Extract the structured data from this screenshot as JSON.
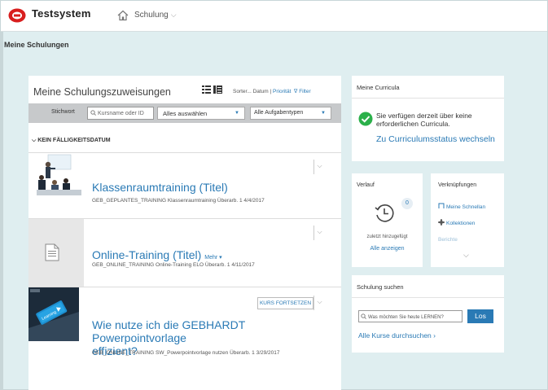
{
  "header": {
    "brand": "Testsystem",
    "nav_label": "Schulung",
    "nav_chevron": "⌵"
  },
  "page": {
    "title": "Meine Schulungen"
  },
  "main": {
    "heading": "Meine Schulungszuweisungen",
    "sort_prefix": "Sorter... Datum | ",
    "sort_priority": "Priorität",
    "sort_filter": "∇ Filter",
    "filter": {
      "keyword_label": "Stichwort",
      "search_placeholder": "Kursname oder ID",
      "select_all": "Alles auswählen",
      "select_types": "Alle Aufgabentypen"
    },
    "due_heading": "⌵ KEIN FÄLLIGKEITSDATUM",
    "items": [
      {
        "title": "Klassenraumtraining (Titel)",
        "meta": "GEB_GEPLANTES_TRAINING Klassenraumtraining Überarb. 1 4/4/2017"
      },
      {
        "title": "Online-Training (Titel)",
        "more": "Mehr ▾",
        "meta": "GEB_ONLINE_TRAINING Online-Training ELO Überarb. 1 4/11/2017"
      },
      {
        "title_line1": "Wie nutze ich die GEBHARDT Powerpointvorlage",
        "title_line2": "effizient?",
        "continue_label": "KURS FORTSETZEN",
        "meta": "GEB_ONLINE_TRAINING SW_Powerpointvorlage nutzen Überarb. 1 3/29/2017"
      }
    ]
  },
  "curricula": {
    "title": "Meine Curricula",
    "text": "Sie verfügen derzeit über keine erforderlichen Curricula.",
    "link": "Zu Curriculumsstatus wechseln"
  },
  "verlauf": {
    "title": "Verlauf",
    "count": "0",
    "sub": "zuletzt hinzugefügt",
    "link": "Alle anzeigen"
  },
  "links": {
    "title": "Verknüpfungen",
    "items": [
      "Meine Schnellan",
      "Kollektionen",
      "Berichte"
    ]
  },
  "search": {
    "title": "Schulung suchen",
    "placeholder": "Was möchten Sie heute LERNEN?",
    "button": "Los",
    "browse": "Alle Kurse durchsuchen ›"
  },
  "colors": {
    "accent": "#2a7ab5",
    "background": "#dfeef0",
    "success": "#2bb04a",
    "logo_red": "#d81e1e"
  },
  "icons": {
    "logo": "gebhardt-logo",
    "home": "home-icon",
    "list_view": "list-view-icon",
    "detail_view": "detail-view-icon",
    "check": "check-circle-icon",
    "history": "history-clock-icon"
  }
}
